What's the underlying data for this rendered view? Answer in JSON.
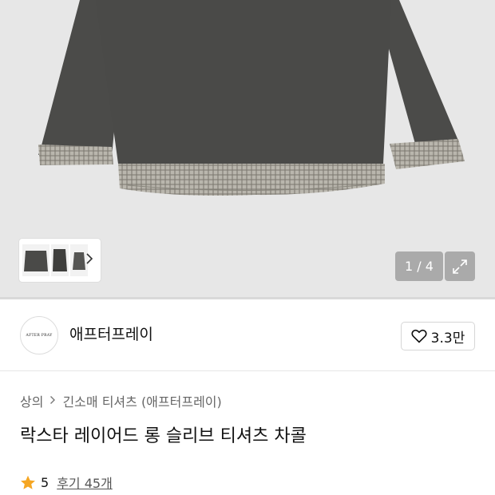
{
  "gallery": {
    "counter": "1 / 4",
    "thumbnail_count": 3
  },
  "brand": {
    "logo_text": "AFTER PRAY",
    "name": "애프터프레이",
    "like_count": "3.3만"
  },
  "breadcrumb": {
    "category": "상의",
    "subcategory": "긴소매 티셔츠 (애프터프레이)"
  },
  "product": {
    "title": "락스타 레이어드 롱 슬리브 티셔츠 차콜",
    "rating": "5",
    "reviews": "후기 45개"
  },
  "icons": [
    "chevron-right-icon",
    "expand-icon",
    "heart-icon",
    "star-icon"
  ],
  "colors": {
    "star": "#f5a623",
    "hero_background": "#e7e7e7",
    "shirt": "#4a4a48"
  }
}
